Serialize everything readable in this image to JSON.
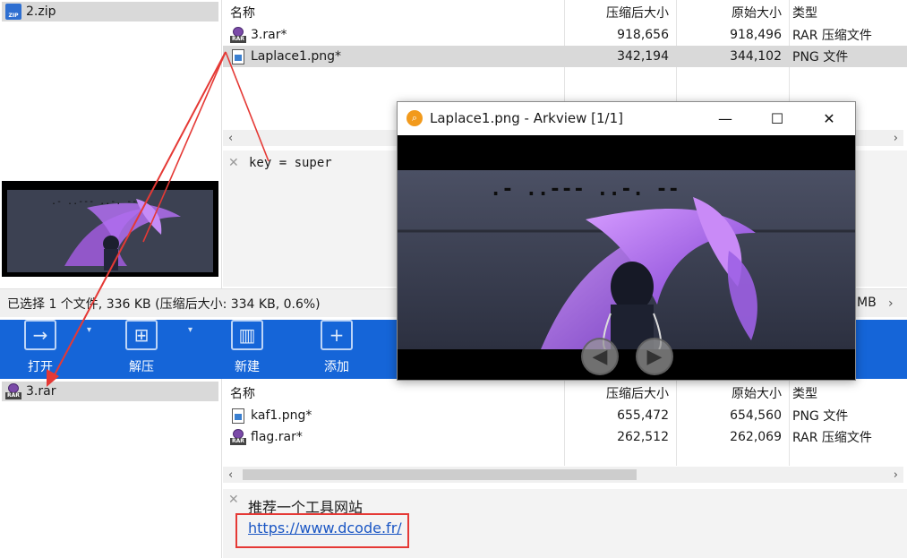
{
  "top_panel": {
    "tree_item": "2.zip",
    "columns": {
      "name": "名称",
      "compressed": "压缩后大小",
      "original": "原始大小",
      "type": "类型"
    },
    "files": [
      {
        "name": "3.rar*",
        "compressed": "918,656",
        "original": "918,496",
        "type": "RAR 压缩文件",
        "icon": "rar-icon"
      },
      {
        "name": "Laplace1.png*",
        "compressed": "342,194",
        "original": "344,102",
        "type": "PNG 文件",
        "icon": "png-icon"
      }
    ],
    "comment": "key = super",
    "status": "已选择 1 个文件, 336 KB (压缩后大小: 334 KB, 0.6%)",
    "status_right": "MB"
  },
  "toolbar": {
    "open": "打开",
    "extract": "解压",
    "new": "新建",
    "add": "添加"
  },
  "bottom_panel": {
    "tree_item": "3.rar",
    "columns": {
      "name": "名称",
      "compressed": "压缩后大小",
      "original": "原始大小",
      "type": "类型"
    },
    "files": [
      {
        "name": "kaf1.png*",
        "compressed": "655,472",
        "original": "654,560",
        "type": "PNG 文件",
        "icon": "png-icon"
      },
      {
        "name": "flag.rar*",
        "compressed": "262,512",
        "original": "262,069",
        "type": "RAR 压缩文件",
        "icon": "rar-icon"
      }
    ],
    "comment": "推荐一个工具网站",
    "link": "https://www.dcode.fr/"
  },
  "viewer": {
    "title": "Laplace1.png - Arkview [1/1]",
    "morse": ".-  ..---  ..-.  --"
  },
  "colors": {
    "toolbar_blue": "#1565d8",
    "annotation_red": "#e53935",
    "selection_gray": "#d9d9d9"
  }
}
